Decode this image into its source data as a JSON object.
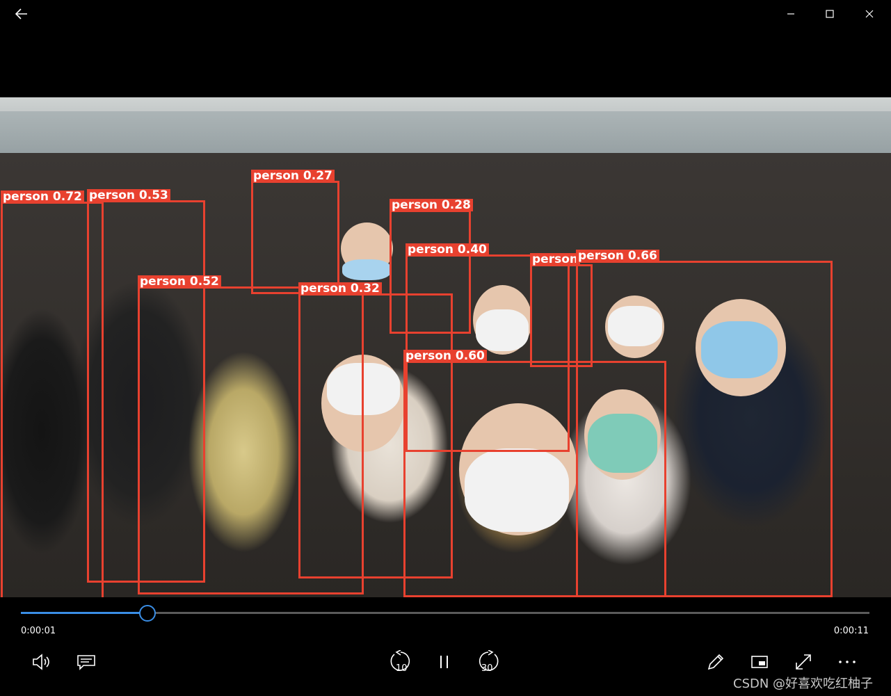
{
  "window": {
    "back_icon": "arrow-left-icon",
    "minimize_icon": "minimize-icon",
    "maximize_icon": "maximize-icon",
    "close_icon": "close-icon"
  },
  "detections": [
    {
      "label": "person 0.72"
    },
    {
      "label": "person 0.53"
    },
    {
      "label": "person 0.27"
    },
    {
      "label": "person 0.28"
    },
    {
      "label": "person 0.40"
    },
    {
      "label": "person 0.52"
    },
    {
      "label": "person 0.32"
    },
    {
      "label": "person 0.60"
    },
    {
      "label": "person 0.66"
    },
    {
      "label": "person"
    }
  ],
  "player": {
    "current_time": "0:00:01",
    "total_time": "0:00:11",
    "progress_fraction": 0.149,
    "accent_color": "#3a8ee6",
    "box_color": "#e8412f",
    "buttons": {
      "volume": "volume-icon",
      "captions": "captions-icon",
      "skip_back": "10",
      "pause": "pause-icon",
      "skip_forward": "30",
      "edit": "pen-icon",
      "mini_view": "mini-view-icon",
      "fullscreen": "fullscreen-icon",
      "more": "more-icon"
    }
  },
  "watermark": "CSDN @好喜欢吃红柚子"
}
